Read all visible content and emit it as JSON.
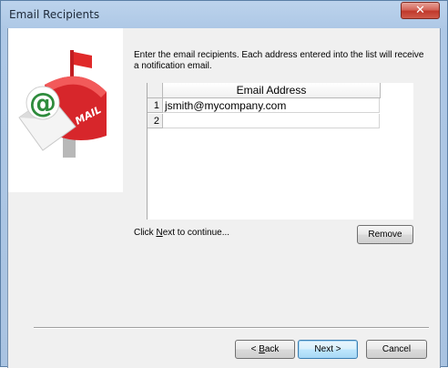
{
  "window": {
    "title": "Email Recipients",
    "close_glyph": "✕"
  },
  "illustration": {
    "icon": "mailbox-icon",
    "mailbox_text": "MAIL",
    "at_symbol": "@"
  },
  "instructions": "Enter the email recipients. Each address entered into the list will receive a notification email.",
  "grid": {
    "column_header": "Email Address",
    "rows": [
      {
        "num": "1",
        "value": "jsmith@mycompany.com"
      },
      {
        "num": "2",
        "value": ""
      }
    ]
  },
  "buttons": {
    "remove": "Remove",
    "back_pre": "< ",
    "back_key": "B",
    "back_post": "ack",
    "next": "Next >",
    "cancel": "Cancel"
  },
  "continue_text": {
    "pre": "Click ",
    "key": "N",
    "post": "ext to continue..."
  },
  "colors": {
    "mailbox_red": "#d7262b",
    "at_green": "#2e8b3c",
    "flag_red": "#e02a2a",
    "title_bar": "#aec8e6"
  }
}
